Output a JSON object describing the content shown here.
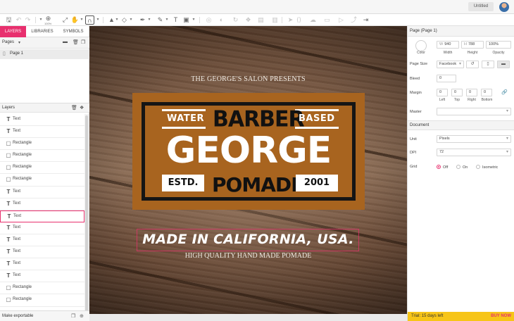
{
  "document": {
    "title": "Untitled"
  },
  "toolbar": {
    "zoom": "100%"
  },
  "left_panel": {
    "tabs": [
      {
        "label": "LAYERS",
        "active": true
      },
      {
        "label": "LIBRARIES",
        "active": false
      },
      {
        "label": "SYMBOLS",
        "active": false
      }
    ],
    "pages_label": "Pages",
    "pages": [
      {
        "label": "Page 1"
      }
    ],
    "layers_label": "Layers",
    "layers": [
      {
        "label": "Text",
        "type": "text",
        "selected": false
      },
      {
        "label": "Text",
        "type": "text",
        "selected": false
      },
      {
        "label": "Rectangle",
        "type": "rect",
        "selected": false
      },
      {
        "label": "Rectangle",
        "type": "rect",
        "selected": false
      },
      {
        "label": "Rectangle",
        "type": "rect",
        "selected": false
      },
      {
        "label": "Rectangle",
        "type": "rect",
        "selected": false
      },
      {
        "label": "Text",
        "type": "text",
        "selected": false
      },
      {
        "label": "Text",
        "type": "text",
        "selected": false
      },
      {
        "label": "Text",
        "type": "text",
        "selected": true
      },
      {
        "label": "Text",
        "type": "text",
        "selected": false
      },
      {
        "label": "Text",
        "type": "text",
        "selected": false
      },
      {
        "label": "Text",
        "type": "text",
        "selected": false
      },
      {
        "label": "Text",
        "type": "text",
        "selected": false
      },
      {
        "label": "Text",
        "type": "text",
        "selected": false
      },
      {
        "label": "Rectangle",
        "type": "rect",
        "selected": false
      },
      {
        "label": "Rectangle",
        "type": "rect",
        "selected": false
      }
    ],
    "make_exportable": "Make exportable"
  },
  "canvas": {
    "presents": "THE GEORGE'S SALON PRESENTS",
    "water": "WATER",
    "barber": "BARBER",
    "based": "BASED",
    "george": "GEORGE",
    "estd": "ESTD.",
    "pomade": "POMADE",
    "year": "2001",
    "made_in": "MADE IN CALIFORNIA, USA.",
    "high_quality": "HIGH QUALITY HAND MADE POMADE",
    "colors": {
      "badge": "#a8641f",
      "badge_border": "#151515",
      "selection": "#e8306e"
    }
  },
  "right_panel": {
    "title": "Page (Page 1)",
    "color_label": "Color",
    "width_prefix": "W",
    "width": "940",
    "width_label": "Width",
    "height_prefix": "H",
    "height": "788",
    "height_label": "Height",
    "opacity": "100%",
    "opacity_label": "Opacity",
    "page_size_label": "Page Size",
    "page_size": "Facebook",
    "bleed_label": "Bleed",
    "bleed": "0",
    "margin_label": "Margin",
    "margins": [
      {
        "value": "0",
        "label": "Left"
      },
      {
        "value": "0",
        "label": "Top"
      },
      {
        "value": "0",
        "label": "Right"
      },
      {
        "value": "0",
        "label": "Bottom"
      }
    ],
    "master_label": "Master",
    "master": "",
    "document_section": "Document",
    "unit_label": "Unit",
    "unit": "Pixels",
    "dpi_label": "DPI",
    "dpi": "72",
    "grid_label": "Grid",
    "grid_options": [
      {
        "label": "Off",
        "selected": true
      },
      {
        "label": "On",
        "selected": false
      },
      {
        "label": "Isometric",
        "selected": false
      }
    ],
    "trial_text": "Trial: 15 days left",
    "buy_now": "BUY NOW"
  }
}
